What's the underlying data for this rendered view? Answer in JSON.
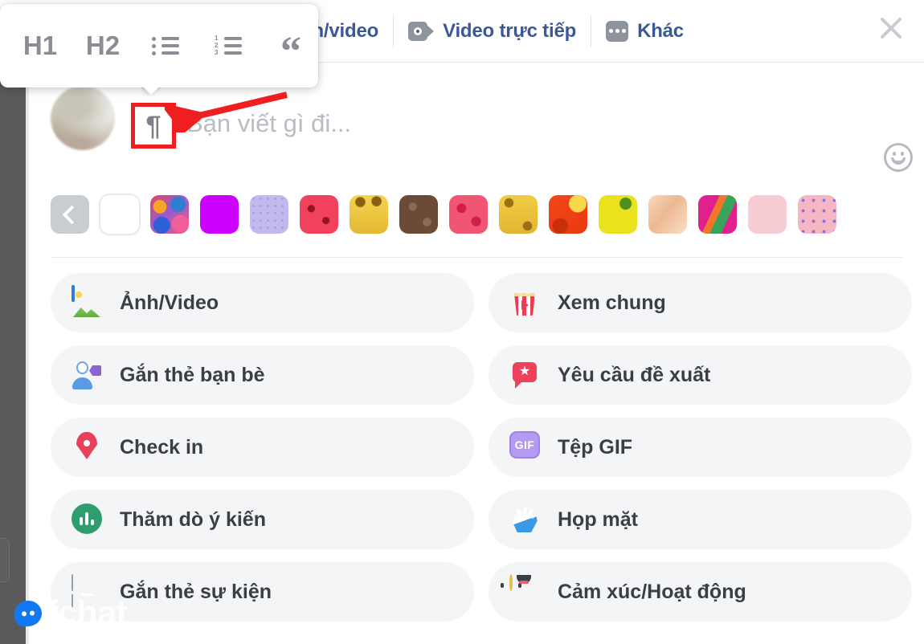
{
  "header": {
    "tabs": [
      {
        "label": "nh/video",
        "icon": "photo-video-icon",
        "truncated": true
      },
      {
        "label": "Video trực tiếp",
        "icon": "live-video-icon"
      },
      {
        "label": "Khác",
        "icon": "more-dots-icon"
      }
    ],
    "close_label": "✕",
    "link_color": "#3b5998"
  },
  "format_toolbar": {
    "items": [
      {
        "label": "H1",
        "name": "heading-1"
      },
      {
        "label": "H2",
        "name": "heading-2"
      },
      {
        "label": "",
        "name": "bulleted-list"
      },
      {
        "label": "",
        "name": "numbered-list"
      },
      {
        "label": "“",
        "name": "block-quote"
      }
    ],
    "list_numbers": [
      "1",
      "2",
      "3"
    ]
  },
  "composer": {
    "paragraph_glyph": "¶",
    "placeholder": "Bạn viết gì đi...",
    "emoji_button": "emoji-icon",
    "highlight_color": "#ef1f1f"
  },
  "backgrounds": {
    "nav_back_label": "‹",
    "swatches": [
      {
        "name": "plain-white",
        "color": "#ffffff"
      },
      {
        "name": "multicolor-blob",
        "color": "#d95a8c"
      },
      {
        "name": "magenta",
        "color": "#cc00ff"
      },
      {
        "name": "lavender-pattern",
        "color": "#b8aee8"
      },
      {
        "name": "red-watermelon",
        "color": "#f2415c"
      },
      {
        "name": "yellow-bee",
        "color": "#efc73f"
      },
      {
        "name": "brown-chocolate",
        "color": "#6b4a36"
      },
      {
        "name": "pink-hearts",
        "color": "#f25574"
      },
      {
        "name": "yellow-gold",
        "color": "#eec63e"
      },
      {
        "name": "orange-red",
        "color": "#f4461c"
      },
      {
        "name": "yellow-green",
        "color": "#eae21c"
      },
      {
        "name": "peach-sand",
        "color": "#f6cfae"
      },
      {
        "name": "magenta-green-wave",
        "color": "#e0208c"
      },
      {
        "name": "light-pink",
        "color": "#f7ccd2"
      },
      {
        "name": "pink-doodle",
        "color": "#f6b6c4"
      }
    ]
  },
  "options": {
    "left_column": [
      {
        "label": "Ảnh/Video",
        "icon": "photo-video-icon"
      },
      {
        "label": "Gắn thẻ bạn bè",
        "icon": "tag-friends-icon"
      },
      {
        "label": "Check in",
        "icon": "location-pin-icon"
      },
      {
        "label": "Thăm dò ý kiến",
        "icon": "poll-icon"
      },
      {
        "label": "Gắn thẻ sự kiện",
        "icon": "calendar-icon"
      }
    ],
    "right_column": [
      {
        "label": "Xem chung",
        "icon": "popcorn-icon"
      },
      {
        "label": "Yêu cầu đề xuất",
        "icon": "recommendation-icon"
      },
      {
        "label": "Tệp GIF",
        "icon": "gif-icon"
      },
      {
        "label": "Họp mặt",
        "icon": "waving-hand-icon"
      },
      {
        "label": "Cảm xúc/Hoạt động",
        "icon": "smiley-icon"
      }
    ]
  },
  "watermark": {
    "text": "fchat",
    "logo": "chat-bubble-icon",
    "color": "#1178f2"
  },
  "annotation": {
    "arrow_color": "#ef1f1f",
    "points_to": "paragraph-format-button"
  }
}
